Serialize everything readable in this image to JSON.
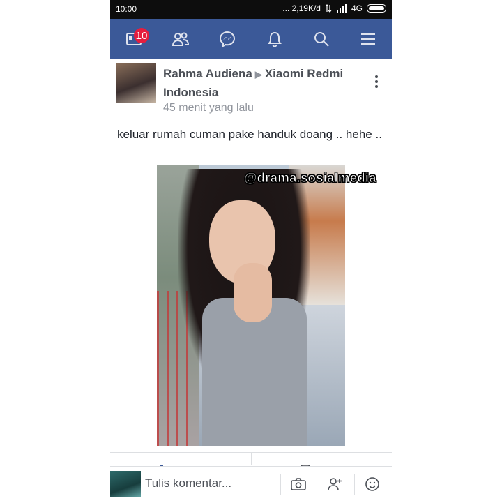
{
  "status_bar": {
    "time": "10:00",
    "network_speed": "... 2,19K/d",
    "network_type": "4G"
  },
  "nav": {
    "notification_count": "10",
    "icons": [
      "news-feed-icon",
      "friends-icon",
      "messenger-icon",
      "bell-icon",
      "search-icon",
      "menu-icon"
    ]
  },
  "post": {
    "author": "Rahma Audiena",
    "target": "Xiaomi Redmi Indonesia",
    "time": "45 menit yang lalu",
    "text": "keluar rumah cuman pake handuk doang .. hehe ..",
    "watermark": "@drama.sosialmedia"
  },
  "comment_bar": {
    "placeholder": "Tulis komentar..."
  },
  "colors": {
    "nav_bg": "#3b5998",
    "badge": "#e41e3f"
  }
}
